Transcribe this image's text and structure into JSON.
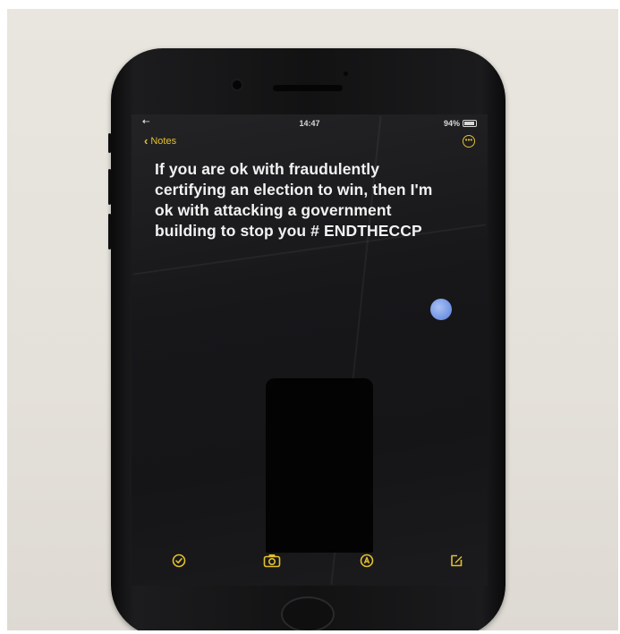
{
  "status_bar": {
    "time": "14:47",
    "battery_text": "94%",
    "battery_level": 0.94,
    "left_indicator": "⇠"
  },
  "nav": {
    "back_label": "Notes",
    "more_icon": "ellipsis-circle-icon"
  },
  "note": {
    "text": "If you are ok with fraudulently certifying an election to win, then I'm ok with attacking a government building to stop you # ENDTHECCP"
  },
  "toolbar": {
    "items": [
      "checklist-icon",
      "camera-icon",
      "markup-icon",
      "compose-icon"
    ]
  },
  "colors": {
    "accent": "#e3c02e",
    "text": "#f2f2f2",
    "background": "#17171a"
  }
}
